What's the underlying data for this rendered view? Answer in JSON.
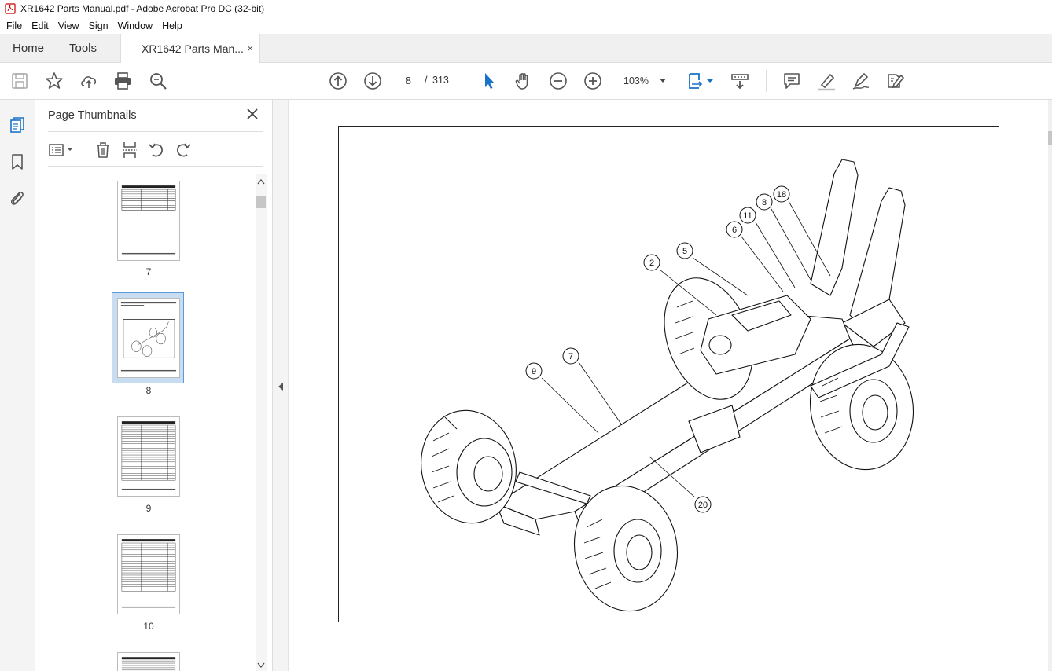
{
  "window": {
    "title": "XR1642 Parts Manual.pdf - Adobe Acrobat Pro DC (32-bit)"
  },
  "menu": {
    "items": [
      "File",
      "Edit",
      "View",
      "Sign",
      "Window",
      "Help"
    ]
  },
  "tabs": {
    "home": "Home",
    "tools": "Tools",
    "document": "XR1642 Parts Man...",
    "close_glyph": "×"
  },
  "toolbar": {
    "icons": [
      "save-icon",
      "bookmark-star-icon",
      "upload-share-icon",
      "print-icon",
      "zoom-search-icon",
      "page-up-icon",
      "page-down-icon",
      "select-pointer-icon",
      "hand-pan-icon",
      "zoom-out-icon",
      "zoom-in-icon",
      "fit-page-icon",
      "scroll-mode-icon",
      "comment-icon",
      "highlight-pen-icon",
      "draw-sign-icon",
      "fill-sign-icon"
    ],
    "current_page": "8",
    "page_separator": "/",
    "total_pages": "313",
    "zoom_level": "103%"
  },
  "left_rail": {
    "icons": [
      "page-thumbnails-icon",
      "bookmarks-icon",
      "attachments-icon"
    ]
  },
  "panel": {
    "title": "Page Thumbnails",
    "tools": [
      "thumbnail-options-icon",
      "delete-page-icon",
      "insert-page-icon",
      "rotate-ccw-icon",
      "rotate-cw-icon"
    ],
    "thumbnails": [
      {
        "label": "7",
        "kind": "table"
      },
      {
        "label": "8",
        "kind": "figure",
        "selected": true
      },
      {
        "label": "9",
        "kind": "table"
      },
      {
        "label": "10",
        "kind": "table"
      }
    ]
  },
  "figure": {
    "callouts": [
      "2",
      "5",
      "6",
      "11",
      "8",
      "18",
      "7",
      "9",
      "20"
    ]
  },
  "colors": {
    "selection_fill": "#c8ddf2",
    "selection_border": "#5b9bd5",
    "icon_blue": "#1a73c8",
    "icon_gray": "#555555"
  }
}
